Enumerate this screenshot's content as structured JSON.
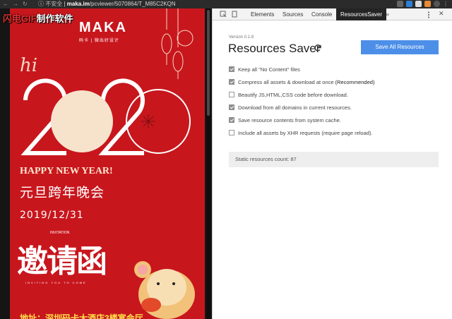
{
  "browser": {
    "security_label": "不安全",
    "host": "maka.im",
    "path": "/pcviewer/5070864/T_M85C2KQN",
    "separator": "|"
  },
  "watermark": {
    "red_text": "闪电GIF",
    "white_text": "制作软件"
  },
  "poster": {
    "logo": "MAKA",
    "logo_sub": "码卡 | 微出好设计",
    "hi": "hi",
    "year": "2020",
    "greeting_en": "HAPPY NEW YEAR!",
    "greeting_cn": "元旦跨年晚会",
    "date": "2019/12/31",
    "invitation_small": "INVITATION",
    "invitation_cn": "邀请函",
    "inviting": "INVITING YOU TO COME",
    "venue": "地址：深圳码卡大酒店3楼宴会厅",
    "colors": {
      "background": "#c8161d",
      "accent": "#ffe14a"
    }
  },
  "devtools": {
    "tabs": [
      {
        "label": "Elements"
      },
      {
        "label": "Sources"
      },
      {
        "label": "Console"
      },
      {
        "label": "ResourcesSaver"
      }
    ],
    "more": "»",
    "active_tab": "ResourcesSaver"
  },
  "resources_saver": {
    "version": "Version 0.1.8",
    "title": "Resources Saver",
    "save_all_label": "Save All Resources",
    "options": [
      {
        "label": "Keep all \"No Content\" files",
        "checked": true,
        "disabled": true
      },
      {
        "label": "Compress all assets & download at once",
        "suffix": "(Recommended)",
        "checked": true,
        "disabled": true
      },
      {
        "label": "Beautify JS,HTML,CSS code before download.",
        "checked": false
      },
      {
        "label": "Download from all domains in current resources.",
        "checked": true
      },
      {
        "label": "Save resource contents from system cache.",
        "checked": true
      },
      {
        "label": "Include all assets by XHR requests (require page reload).",
        "checked": false
      }
    ],
    "stats_label": "Static resources count: 87",
    "colors": {
      "button": "#4d8fe8"
    }
  }
}
